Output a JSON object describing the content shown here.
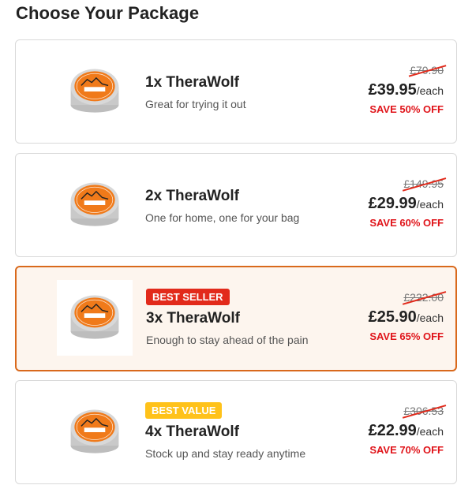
{
  "page": {
    "heading": "Choose Your Package"
  },
  "packages": [
    {
      "title": "1x TheraWolf",
      "subtitle": "Great for trying it out",
      "badge": "",
      "old_price": "£70.90",
      "price": "£39.95",
      "per": "/each",
      "save": "SAVE 50% OFF",
      "selected": false
    },
    {
      "title": "2x TheraWolf",
      "subtitle": "One for home, one for your bag",
      "badge": "",
      "old_price": "£149.95",
      "price": "£29.99",
      "per": "/each",
      "save": "SAVE 60% OFF",
      "selected": false
    },
    {
      "title": "3x TheraWolf",
      "subtitle": "Enough to stay ahead of the pain",
      "badge": "BEST SELLER",
      "old_price": "£222.00",
      "price": "£25.90",
      "per": "/each",
      "save": "SAVE 65% OFF",
      "selected": true
    },
    {
      "title": "4x TheraWolf",
      "subtitle": "Stock up and stay ready anytime",
      "badge": "BEST VALUE",
      "old_price": "£306.53",
      "price": "£22.99",
      "per": "/each",
      "save": "SAVE 70% OFF",
      "selected": false
    }
  ],
  "product_image": {
    "icon": "therawolf-tin-icon",
    "logo_text": "THERA WOLF"
  },
  "colors": {
    "selected_border": "#d9691c",
    "selected_bg": "#fdf5ee",
    "save_red": "#e0141a",
    "badge_red": "#e22a1b",
    "badge_yellow": "#ffc21a",
    "tin_orange": "#f07a1a"
  }
}
